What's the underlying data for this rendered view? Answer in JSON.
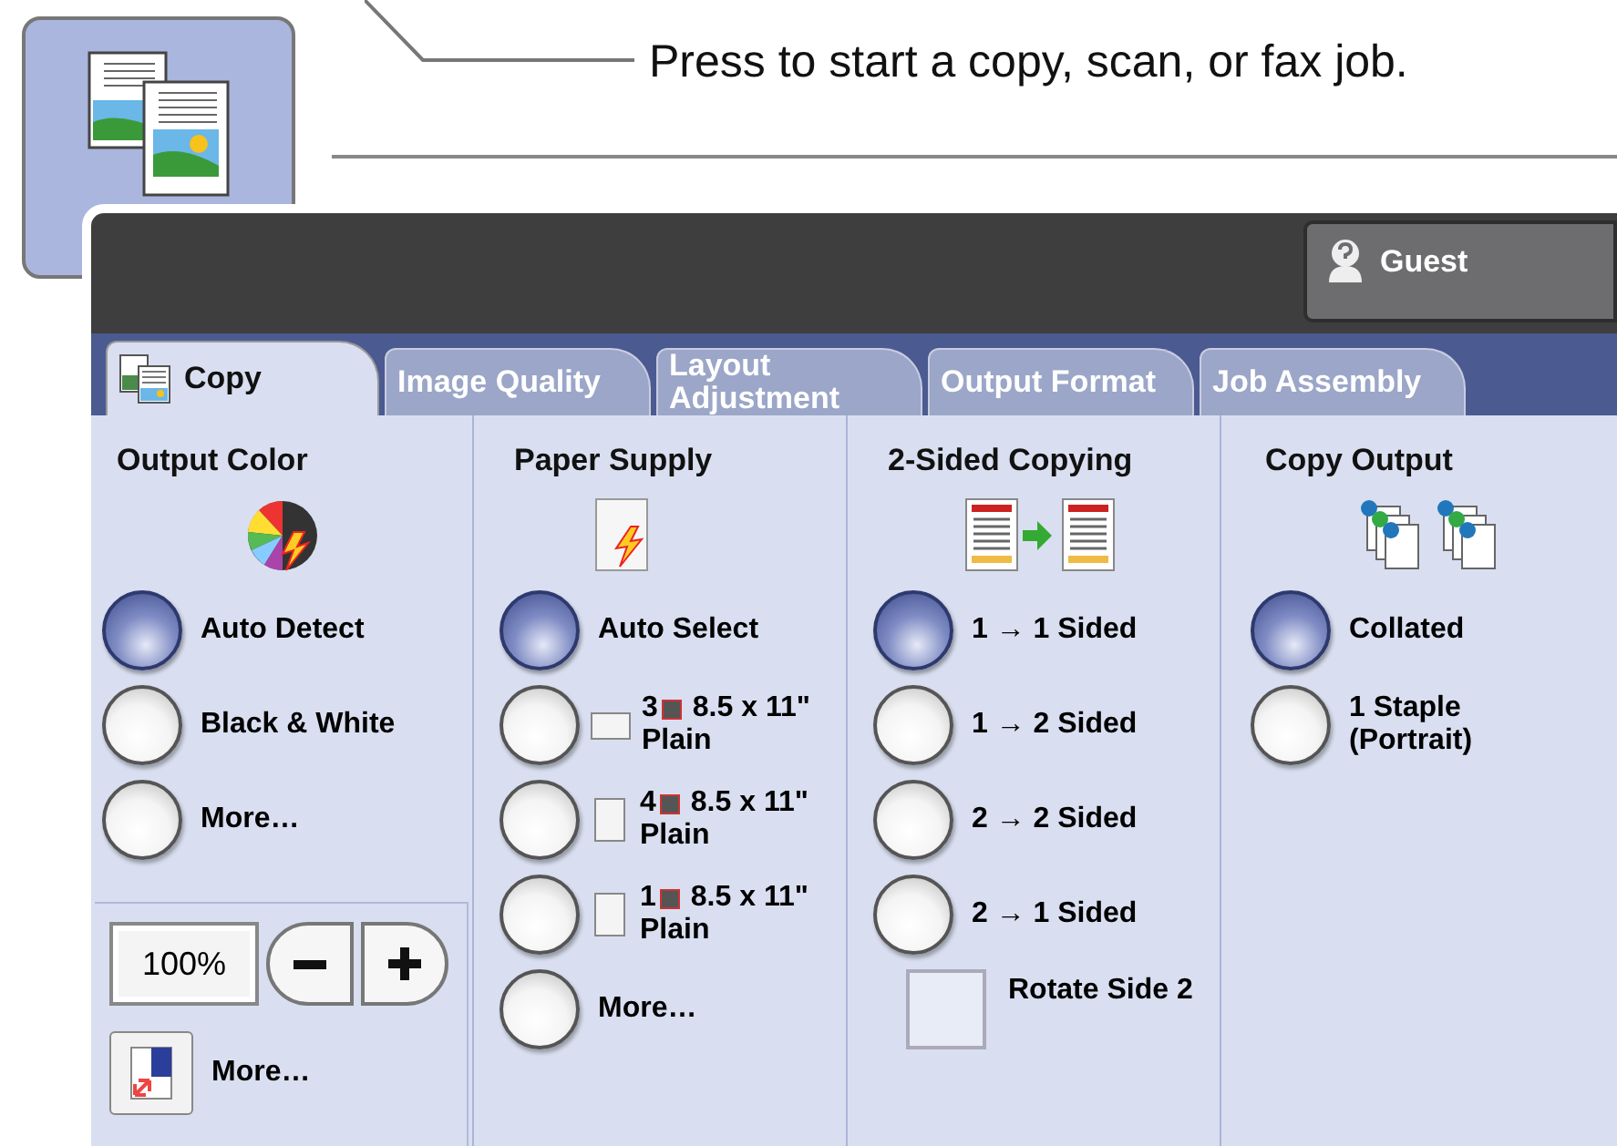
{
  "callout": "Press to start a copy, scan, or fax job.",
  "user_button": {
    "label": "Guest"
  },
  "tabs": [
    {
      "label": "Copy",
      "selected": true
    },
    {
      "label": "Image Quality",
      "selected": false
    },
    {
      "label": "Layout Adjustment",
      "selected": false
    },
    {
      "label": "Output Format",
      "selected": false
    },
    {
      "label": "Job Assembly",
      "selected": false
    }
  ],
  "groups": [
    {
      "title": "Output Color",
      "options": [
        {
          "kind": "radio",
          "label": "Auto Detect",
          "selected": true
        },
        {
          "kind": "radio",
          "label": "Black & White",
          "selected": false
        },
        {
          "kind": "radio",
          "label": "More…",
          "selected": false
        }
      ]
    },
    {
      "title": "Paper Supply",
      "options": [
        {
          "kind": "radio",
          "label": "Auto Select",
          "selected": true
        },
        {
          "kind": "tray",
          "tray": "3",
          "size": "8.5 x 11\"",
          "type": "Plain",
          "landscape": true,
          "selected": false
        },
        {
          "kind": "tray",
          "tray": "4",
          "size": "8.5 x 11\"",
          "type": "Plain",
          "landscape": false,
          "selected": false
        },
        {
          "kind": "tray",
          "tray": "1",
          "size": "8.5 x 11\"",
          "type": "Plain",
          "landscape": false,
          "selected": false
        },
        {
          "kind": "radio",
          "label": "More…",
          "selected": false
        }
      ]
    },
    {
      "title": "2-Sided Copying",
      "options": [
        {
          "kind": "radio",
          "label": "1 → 1 Sided",
          "selected": true
        },
        {
          "kind": "radio",
          "label": "1 → 2 Sided",
          "selected": false
        },
        {
          "kind": "radio",
          "label": "2 → 2 Sided",
          "selected": false
        },
        {
          "kind": "radio",
          "label": "2 → 1 Sided",
          "selected": false
        },
        {
          "kind": "checkbox",
          "label": "Rotate Side 2",
          "checked": false
        }
      ]
    },
    {
      "title": "Copy Output",
      "options": [
        {
          "kind": "radio",
          "label": "Collated",
          "selected": true
        },
        {
          "kind": "radio",
          "label": "1 Staple (Portrait)",
          "selected": false
        }
      ]
    }
  ],
  "reduce_enlarge": {
    "value": "100%",
    "more_label": "More…"
  }
}
